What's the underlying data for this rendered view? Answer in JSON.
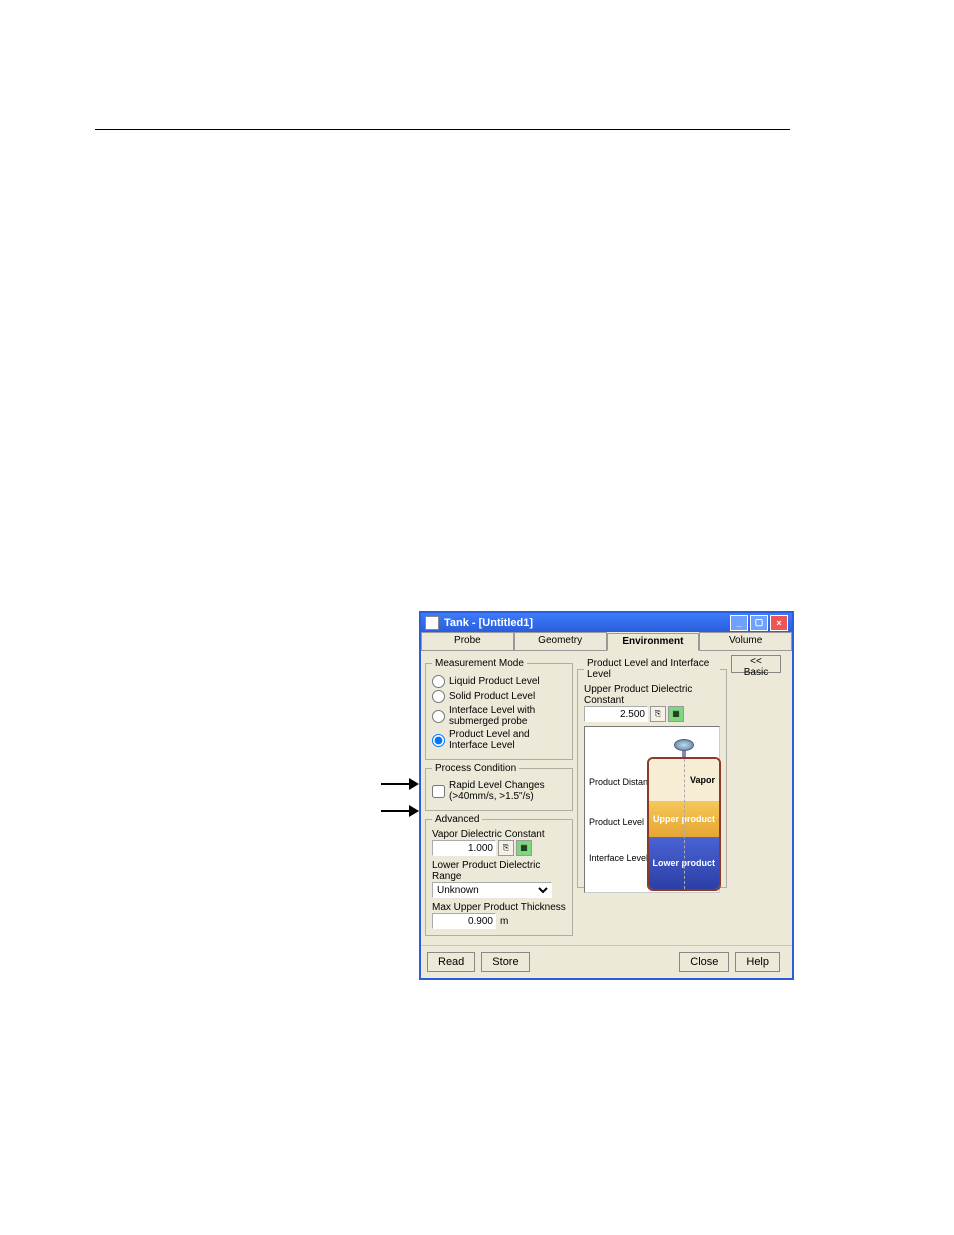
{
  "window": {
    "title": "Tank - [Untitled1]"
  },
  "tabs": {
    "probe": "Probe",
    "geometry": "Geometry",
    "environment": "Environment",
    "volume": "Volume"
  },
  "measurement": {
    "legend": "Measurement Mode",
    "opt1": "Liquid Product Level",
    "opt2": "Solid Product Level",
    "opt3": "Interface Level with submerged probe",
    "opt4": "Product Level and Interface Level"
  },
  "process": {
    "legend": "Process Condition",
    "chk": "Rapid Level Changes (>40mm/s, >1.5\"/s)"
  },
  "advanced": {
    "legend": "Advanced",
    "vdc_label": "Vapor Dielectric Constant",
    "vdc_value": "1.000",
    "lpdr_label": "Lower Product Dielectric Range",
    "lpdr_value": "Unknown",
    "mupt_label": "Max Upper Product Thickness",
    "mupt_value": "0.900",
    "mupt_unit": "m"
  },
  "pli": {
    "legend": "Product Level and Interface Level",
    "updc_label": "Upper Product Dielectric Constant",
    "updc_value": "2.500",
    "lbl_pd": "Product Distance",
    "lbl_pl": "Product Level",
    "lbl_il": "Interface Level",
    "layer_vapor": "Vapor",
    "layer_upper": "Upper product",
    "layer_lower": "Lower product"
  },
  "basic_btn": "<< Basic",
  "buttons": {
    "read": "Read",
    "store": "Store",
    "close": "Close",
    "help": "Help"
  }
}
